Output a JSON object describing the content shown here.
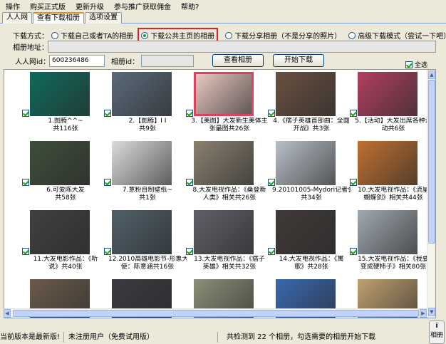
{
  "menu": [
    "操作",
    "购买正式版",
    "更新升级",
    "参与推广获取佣金",
    "帮助?"
  ],
  "tabs": [
    "人人网",
    "查看下载相册",
    "选项设置"
  ],
  "form": {
    "mode_label": "下载方式：",
    "options": [
      "下载自己或者TA的相册",
      "下载公共主页的相册",
      "下载分享相册（不是分享的照片）",
      "高级下载模式（尝试一下吧）"
    ],
    "selected_option": 1,
    "album_url_label": "相册地址：",
    "renren_id_label": "人人网id：",
    "renren_id_value": "600236486",
    "album_id_label": "相册id：",
    "view_button": "查看相册",
    "download_button": "开始下载",
    "select_all": "全选"
  },
  "items": [
    {
      "l1": "1.图腾^^~",
      "l2": "共116张",
      "c": "#0e6a5c"
    },
    {
      "l1": "2.【图腾】I I",
      "l2": "共9张",
      "c": "#5a6a7a"
    },
    {
      "l1": "3.【美图】大发新生美体主",
      "l2": "张最图共26张",
      "c": "#e8c8c0"
    },
    {
      "l1": "4.《痞子英雄首部曲：全面",
      "l2": "开战》共3张",
      "c": "#6a5040"
    },
    {
      "l1": "5.【活动】大发出席各种活",
      "l2": "动共6张",
      "c": "#b04060"
    },
    {
      "l1": "6.可爱陈大发",
      "l2": "共58张",
      "c": "#3e4e3a"
    },
    {
      "l1": "7.意粉自制壁纸~",
      "l2": "共1张",
      "c": "#dcdcdc"
    },
    {
      "l1": "8.大发电视作品：《桑登新",
      "l2": "人类》相关共26张",
      "c": "#8a8070"
    },
    {
      "l1": "9.20101005-Mydori记者会~",
      "l2": "共34张",
      "c": "#b8c0c8"
    },
    {
      "l1": "10.大发电视作品：《流星",
      "l2": "蝴蝶剑》相关共44张",
      "c": "#c07030"
    },
    {
      "l1": "11.大发电影作品：《听",
      "l2": "说》共40张",
      "c": "#404040"
    },
    {
      "l1": "12.2010高雄电影节-形象大",
      "l2": "使：陈意涵共16张",
      "c": "#50606a"
    },
    {
      "l1": "13.大发电视作品：《痞子",
      "l2": "英雄》相关共32张",
      "c": "#606068"
    },
    {
      "l1": "14.大发电视作品：《寓",
      "l2": "歌》共28张",
      "c": "#403a38"
    },
    {
      "l1": "15.大发电视作品：《我要",
      "l2": "变成硬柿子》相关80张",
      "c": "#a0a8b0"
    },
    {
      "l1": "",
      "l2": "",
      "c": "#6a5a4a"
    },
    {
      "l1": "",
      "l2": "",
      "c": "#3a3a40"
    },
    {
      "l1": "",
      "l2": "",
      "c": "#8a9078"
    },
    {
      "l1": "",
      "l2": "",
      "c": "#3868b0"
    },
    {
      "l1": "",
      "l2": "",
      "c": "#c0a070"
    }
  ],
  "status": {
    "version": "当前版本是最新版!",
    "user": "未注册用户（免费试用版）",
    "summary": "共检测到 22 个相册，勾选需要的相册开始下载"
  },
  "corner_label": "相册"
}
